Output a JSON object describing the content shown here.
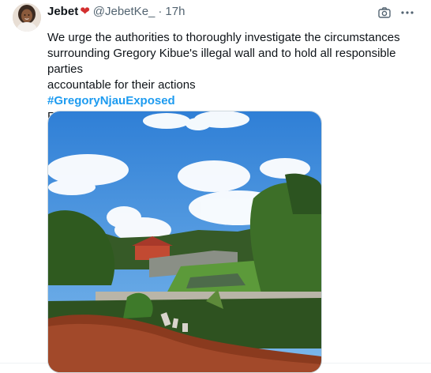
{
  "tweet": {
    "display_name": "Jebet",
    "name_emoji": "❤",
    "handle": "@JebetKe_",
    "separator": "·",
    "time": "17h",
    "body_line1": "We urge the authorities to thoroughly investigate the circumstances",
    "body_line2": "surrounding Gregory Kibue's illegal wall and to hold all responsible parties",
    "body_line3": "accountable for their actions",
    "hashtag": "#GregoryNjauExposed",
    "signature": "Rogue Kibue"
  },
  "icons": {
    "camera": "camera-icon",
    "more": "more-options-icon"
  },
  "colors": {
    "text": "#0f1419",
    "secondary": "#536471",
    "hashtag": "#1d9bf0",
    "heart": "#d32f2f"
  }
}
